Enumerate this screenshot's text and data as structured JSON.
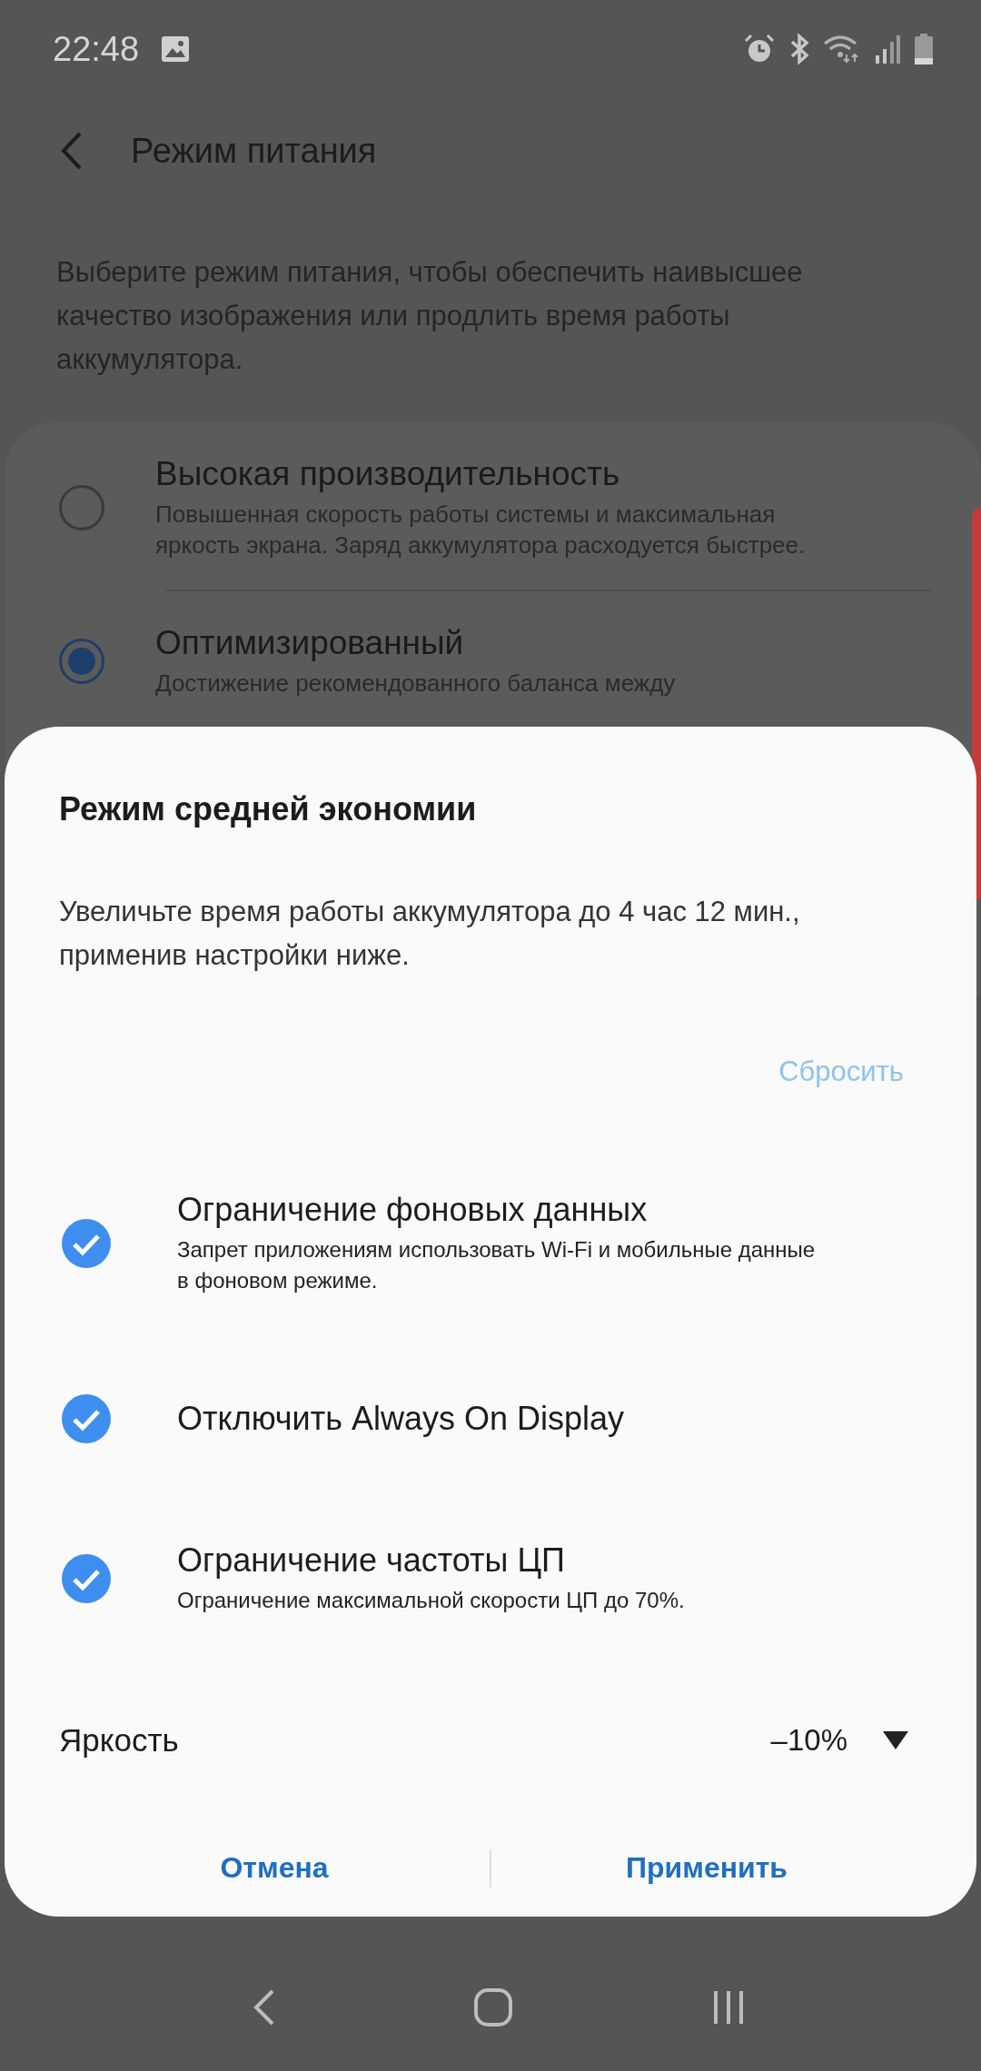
{
  "status_bar": {
    "time": "22:48"
  },
  "header": {
    "title": "Режим питания"
  },
  "intro": "Выберите режим питания, чтобы обеспечить наивысшее качество изображения или продлить время работы аккумулятора.",
  "modes": [
    {
      "title": "Высокая производительность",
      "description": "Повышенная скорость работы системы и максимальная яркость экрана. Заряд аккумулятора расходуется быстрее.",
      "selected": false
    },
    {
      "title": "Оптимизированный",
      "description": "Достижение рекомендованного баланса между",
      "selected": true
    }
  ],
  "dialog": {
    "title": "Режим средней экономии",
    "description": "Увеличьте время работы аккумулятора до 4 час 12 мин., применив настройки ниже.",
    "reset_label": "Сбросить",
    "options": [
      {
        "title": "Ограничение фоновых данных",
        "subtitle": "Запрет приложениям использовать Wi-Fi и мобильные данные в фоновом режиме.",
        "checked": true
      },
      {
        "title": "Отключить Always On Display",
        "checked": true
      },
      {
        "title": "Ограничение частоты ЦП",
        "subtitle": "Ограничение максимальной скорости ЦП до 70%.",
        "checked": true
      }
    ],
    "brightness": {
      "label": "Яркость",
      "value": "–10%"
    },
    "buttons": [
      "Отмена",
      "Применить"
    ]
  }
}
